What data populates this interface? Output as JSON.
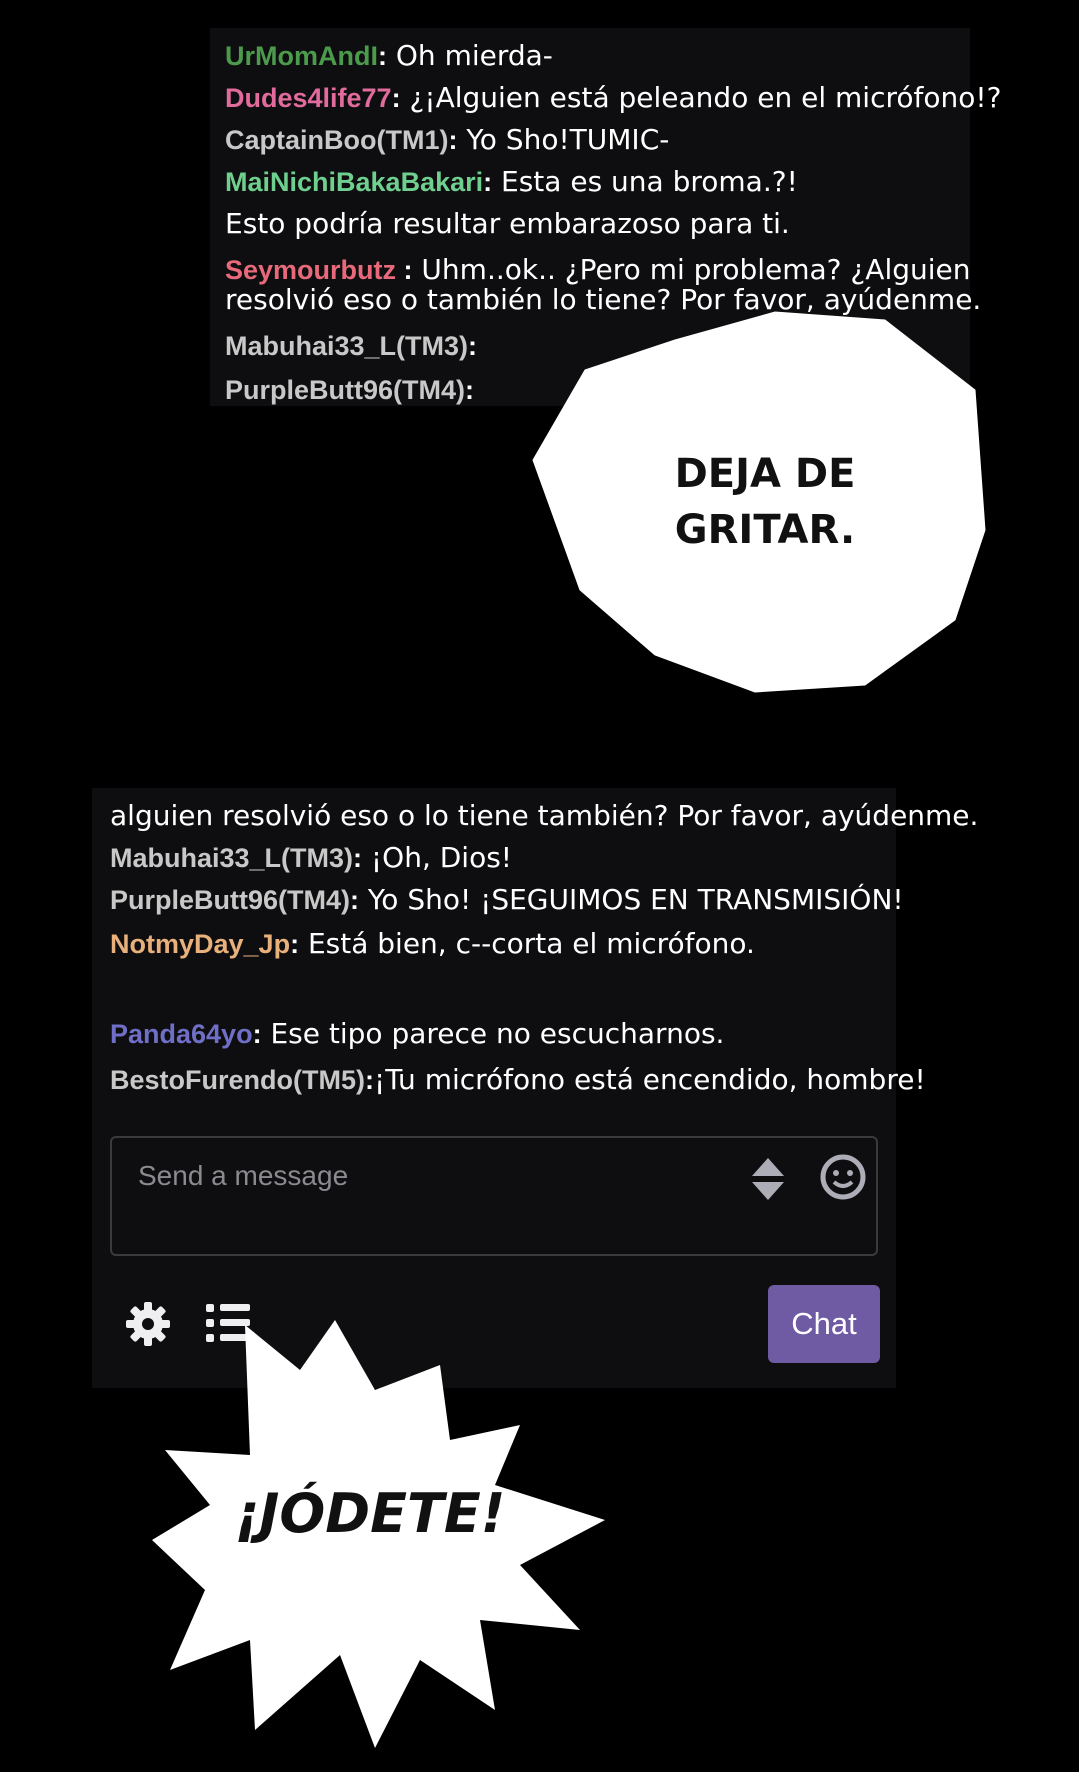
{
  "chat_top": [
    {
      "user": "UrMomAndI",
      "sep": ":",
      "message": " Oh mierda-",
      "color": "#4c9a4c"
    },
    {
      "user": "Dudes4life77",
      "sep": ":",
      "message": " ¿¡Alguien está peleando en el micrófono!?",
      "color": "#e06b9c"
    },
    {
      "user": "CaptainBoo(TM1)",
      "sep": ":",
      "message": " Yo Sho!TUMIC-",
      "color": "#c8c8c8"
    },
    {
      "user": "MaiNichiBakaBakari",
      "sep": ":",
      "message": " Esta es una broma.?!",
      "color": "#6fcf8f"
    },
    {
      "user": "",
      "sep": "",
      "message": " Esto podría resultar embarazoso para ti.",
      "color": "#ffffff"
    },
    {
      "user": "Seymourbutz",
      "sep": " :",
      "message": " Uhm..ok.. ¿Pero mi problema? ¿Alguien",
      "color": "#e86a7a"
    },
    {
      "user": "",
      "sep": "",
      "message": "resolvió eso o también lo tiene? Por favor, ayúdenme.",
      "color": "#ffffff"
    },
    {
      "user": "Mabuhai33_L(TM3)",
      "sep": ":",
      "message": "",
      "color": "#c8c8c8"
    },
    {
      "user": "PurpleButt96(TM4)",
      "sep": ":",
      "message": "",
      "color": "#c8c8c8"
    }
  ],
  "bubble_1": {
    "line1": "DEJA DE",
    "line2": "GRITAR."
  },
  "chat_bottom": [
    {
      "user": "",
      "sep": "",
      "message": "alguien resolvió eso o lo tiene también? Por favor, ayúdenme.",
      "color": "#ffffff"
    },
    {
      "user": "Mabuhai33_L(TM3)",
      "sep": ":",
      "message": " ¡Oh, Dios!",
      "color": "#c8c8c8"
    },
    {
      "user": "PurpleButt96(TM4)",
      "sep": ":",
      "message": " Yo Sho! ¡SEGUIMOS EN TRANSMISIÓN!",
      "color": "#c8c8c8"
    },
    {
      "user": "NotmyDay_Jp",
      "sep": ":",
      "message": " Está bien, c--corta el micrófono.",
      "color": "#e8b07a"
    },
    {
      "user": "Panda64yo",
      "sep": ":",
      "message": " Ese tipo parece no escucharnos.",
      "color": "#6f6fc8"
    },
    {
      "user": "BestoFurendo(TM5)",
      "sep": ":",
      "message": "¡Tu micrófono está encendido, hombre!",
      "color": "#c8c8c8"
    }
  ],
  "input": {
    "placeholder": "Send a message"
  },
  "chat_button": "Chat",
  "bubble_2": {
    "text": "¡JÓDETE!"
  },
  "icons": {
    "up_down": "sort-arrows-icon",
    "emote": "smiley-icon",
    "settings": "gear-icon",
    "list": "list-icon"
  }
}
